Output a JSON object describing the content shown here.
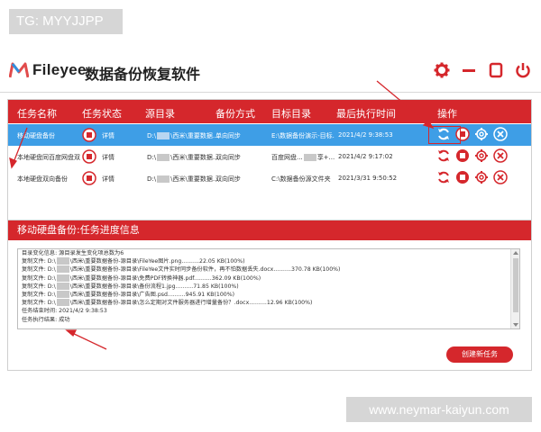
{
  "watermarks": {
    "top": "TG: MYYJJPP",
    "bottom": "www.neymar-kaiyun.com"
  },
  "app": {
    "brand": "Fileyee",
    "title": "数据备份恢复软件"
  },
  "window_controls": [
    "gear-icon",
    "minimize-icon",
    "restore-icon",
    "power-icon"
  ],
  "colors": {
    "accent": "#d5272c",
    "selected_row": "#3e9ee6"
  },
  "task_table": {
    "headers": [
      "任务名称",
      "任务状态",
      "源目录",
      "备份方式",
      "目标目录",
      "最后执行时间",
      "操作"
    ],
    "rows": [
      {
        "name": "移动硬盘备份",
        "detail": "详情",
        "src_a": "D:\\",
        "src_b": "\\西米\\重要数据...",
        "mode": "单向同步",
        "dest": "E:\\数据备份演示-目标...",
        "last_run": "2021/4/2 9:38:53",
        "selected": true
      },
      {
        "name": "本地硬盘同百度网盘双向...",
        "detail": "详情",
        "src_a": "D:\\",
        "src_b": "\\西米\\重要数据...",
        "mode": "双向同步",
        "dest_a": "百度网盘...",
        "dest_b": "享+...",
        "last_run": "2021/4/2 9:17:02",
        "selected": false
      },
      {
        "name": "本地硬盘双向备份",
        "detail": "详情",
        "src_a": "D:\\",
        "src_b": "\\西米\\重要数据...",
        "mode": "双向同步",
        "dest": "C:\\数据备份源文件夹",
        "last_run": "2021/3/31 9:50:52",
        "selected": false
      }
    ]
  },
  "progress": {
    "title": "移动硬盘备份:任务进度信息",
    "log": [
      {
        "a": "目录变化信息:  源目录发生变化项总数为6",
        "b": ""
      },
      {
        "a": "复制文件:  D:\\",
        "b": "\\西米\\重要数据备份-源目录\\FileYee图片.png..........22.05 KB(100%)"
      },
      {
        "a": "复制文件:  D:\\",
        "b": "\\西米\\重要数据备份-源目录\\FileYee文件实时同步备份软件，再不怕数据丢失.docx..........370.78 KB(100%)"
      },
      {
        "a": "复制文件:  D:\\",
        "b": "\\西米\\重要数据备份-源目录\\免费PDF转换神器.pdf..........362.09 KB(100%)"
      },
      {
        "a": "复制文件:  D:\\",
        "b": "\\西米\\重要数据备份-源目录\\备份流程1.jpg..........71.85 KB(100%)"
      },
      {
        "a": "复制文件:  D:\\",
        "b": "\\西米\\重要数据备份-源目录\\广告图.psd..........945.91 KB(100%)"
      },
      {
        "a": "复制文件:  D:\\",
        "b": "\\西米\\重要数据备份-源目录\\怎么定期对文件服务器进行增量备份？.docx..........12.96 KB(100%)"
      },
      {
        "a": "任务结束时间:  2021/4/2 9:38:53",
        "b": ""
      },
      {
        "a": "任务执行结果:  成功",
        "b": ""
      }
    ],
    "new_task_label": "创建新任务"
  }
}
